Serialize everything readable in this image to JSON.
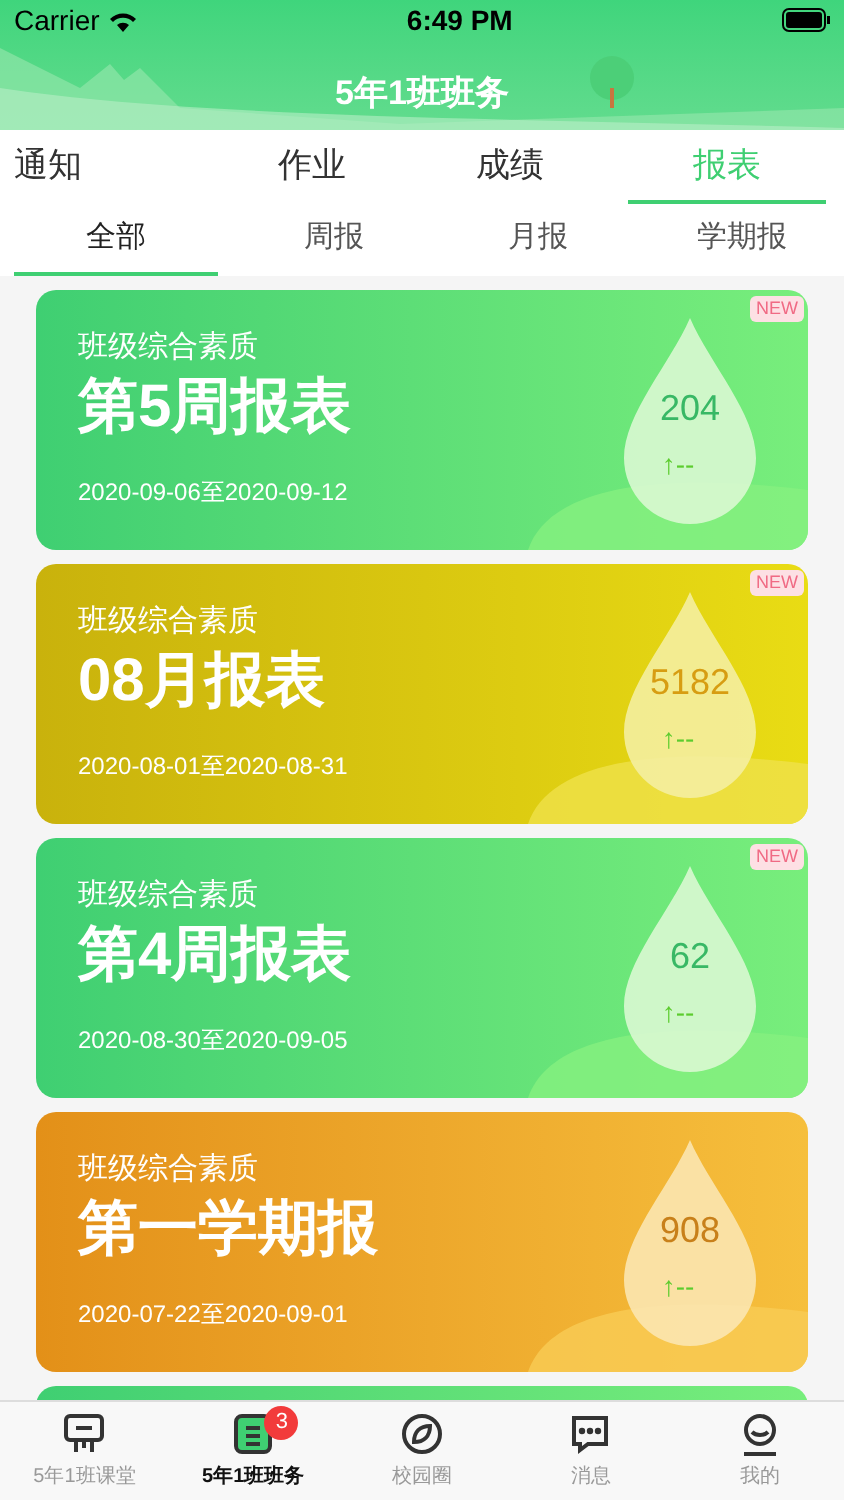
{
  "status_bar": {
    "carrier": "Carrier",
    "time": "6:49 PM"
  },
  "header": {
    "title": "5年1班班务"
  },
  "tabs": [
    {
      "label": "通知",
      "selected": false
    },
    {
      "label": "作业",
      "selected": false
    },
    {
      "label": "成绩",
      "selected": false
    },
    {
      "label": "报表",
      "selected": true
    }
  ],
  "sub_tabs": [
    {
      "label": "全部",
      "selected": true
    },
    {
      "label": "周报",
      "selected": false
    },
    {
      "label": "月报",
      "selected": false
    },
    {
      "label": "学期报",
      "selected": false
    }
  ],
  "reports": [
    {
      "kind": "weekly",
      "subtitle": "班级综合素质",
      "title": "第5周报表",
      "date_range": "2020-09-06至2020-09-12",
      "score": "204",
      "trend": "↑--",
      "is_new": true,
      "badge": "NEW"
    },
    {
      "kind": "monthly",
      "subtitle": "班级综合素质",
      "title": "08月报表",
      "date_range": "2020-08-01至2020-08-31",
      "score": "5182",
      "trend": "↑--",
      "is_new": true,
      "badge": "NEW"
    },
    {
      "kind": "weekly",
      "subtitle": "班级综合素质",
      "title": "第4周报表",
      "date_range": "2020-08-30至2020-09-05",
      "score": "62",
      "trend": "↑--",
      "is_new": true,
      "badge": "NEW"
    },
    {
      "kind": "semester",
      "subtitle": "班级综合素质",
      "title": "第一学期报",
      "date_range": "2020-07-22至2020-09-01",
      "score": "908",
      "trend": "↑--",
      "is_new": false
    }
  ],
  "partial_card": {
    "kind": "weekly"
  },
  "tab_bar": [
    {
      "label": "5年1班课堂",
      "kind": "class",
      "selected": false
    },
    {
      "label": "5年1班班务",
      "kind": "affairs",
      "selected": true,
      "badge": "3"
    },
    {
      "label": "校园圈",
      "kind": "campus",
      "selected": false
    },
    {
      "label": "消息",
      "kind": "messages",
      "selected": false
    },
    {
      "label": "我的",
      "kind": "profile",
      "selected": false
    }
  ]
}
